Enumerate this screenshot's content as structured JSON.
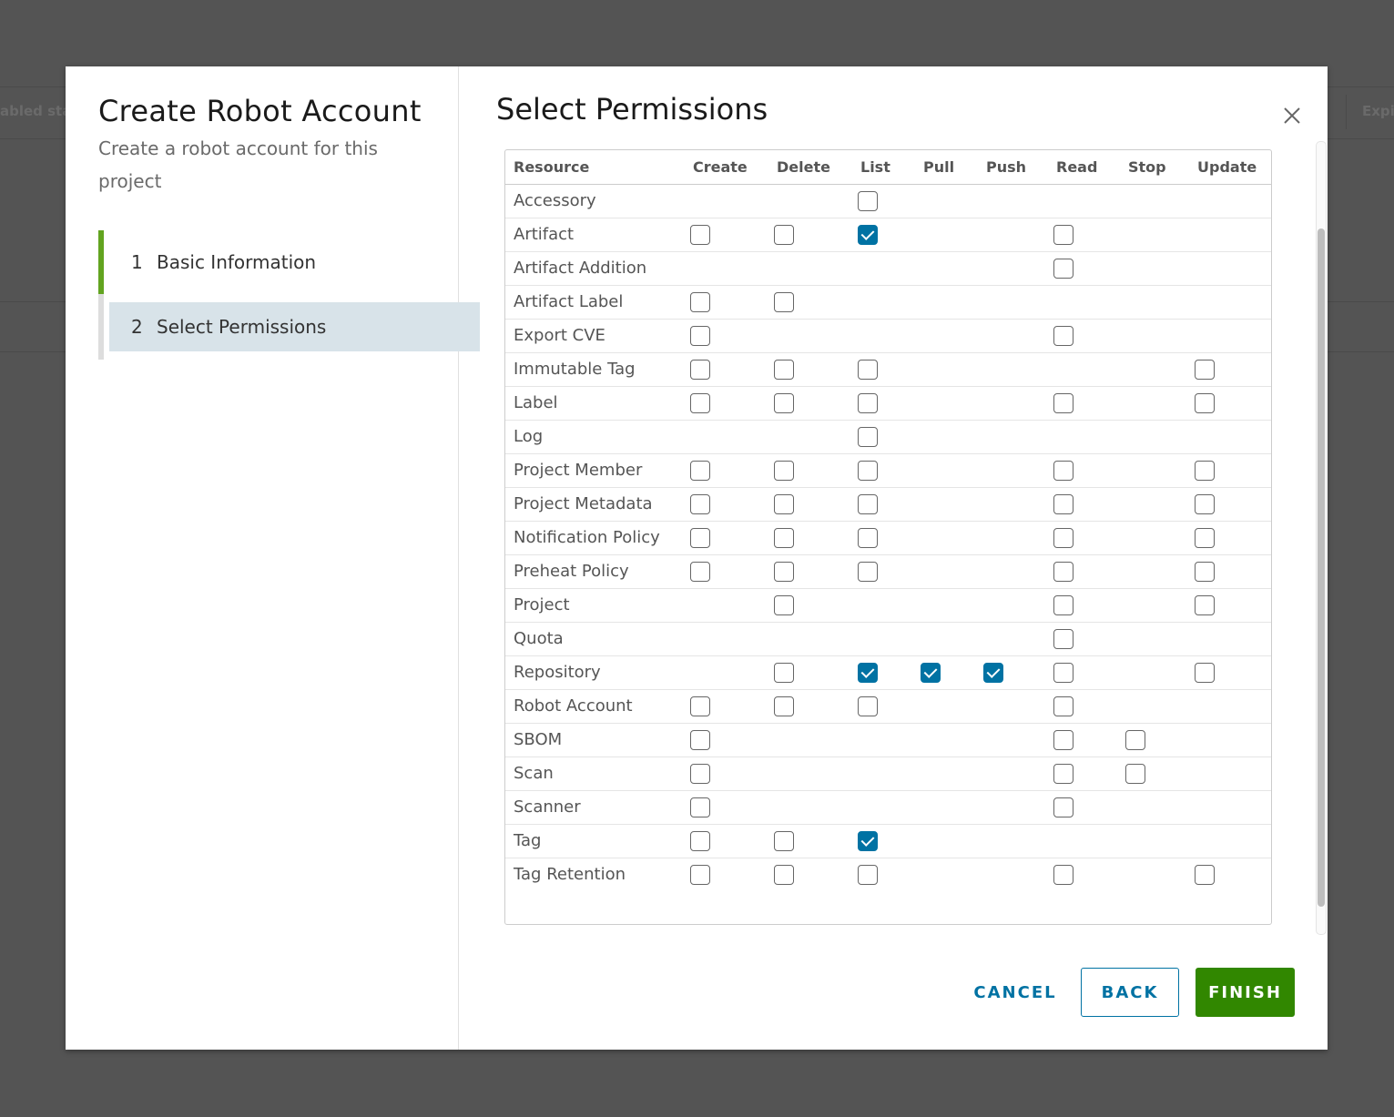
{
  "background": {
    "left_text": "abled sta",
    "right_text": "Expi"
  },
  "wizard": {
    "title": "Create Robot Account",
    "subtitle": "Create a robot account for this project",
    "steps": [
      {
        "num": "1",
        "label": "Basic Information"
      },
      {
        "num": "2",
        "label": "Select Permissions"
      }
    ]
  },
  "content": {
    "title": "Select Permissions"
  },
  "table": {
    "columns": [
      "Resource",
      "Create",
      "Delete",
      "List",
      "Pull",
      "Push",
      "Read",
      "Stop",
      "Update"
    ],
    "rows": [
      {
        "resource": "Accessory",
        "perms": {
          "list": false
        }
      },
      {
        "resource": "Artifact",
        "perms": {
          "create": false,
          "delete": false,
          "list": true,
          "read": false
        }
      },
      {
        "resource": "Artifact Addition",
        "perms": {
          "read": false
        }
      },
      {
        "resource": "Artifact Label",
        "perms": {
          "create": false,
          "delete": false
        }
      },
      {
        "resource": "Export CVE",
        "perms": {
          "create": false,
          "read": false
        }
      },
      {
        "resource": "Immutable Tag",
        "perms": {
          "create": false,
          "delete": false,
          "list": false,
          "update": false
        }
      },
      {
        "resource": "Label",
        "perms": {
          "create": false,
          "delete": false,
          "list": false,
          "read": false,
          "update": false
        }
      },
      {
        "resource": "Log",
        "perms": {
          "list": false
        }
      },
      {
        "resource": "Project Member",
        "perms": {
          "create": false,
          "delete": false,
          "list": false,
          "read": false,
          "update": false
        }
      },
      {
        "resource": "Project Metadata",
        "perms": {
          "create": false,
          "delete": false,
          "list": false,
          "read": false,
          "update": false
        }
      },
      {
        "resource": "Notification Policy",
        "perms": {
          "create": false,
          "delete": false,
          "list": false,
          "read": false,
          "update": false
        }
      },
      {
        "resource": "Preheat Policy",
        "perms": {
          "create": false,
          "delete": false,
          "list": false,
          "read": false,
          "update": false
        }
      },
      {
        "resource": "Project",
        "perms": {
          "delete": false,
          "read": false,
          "update": false
        }
      },
      {
        "resource": "Quota",
        "perms": {
          "read": false
        }
      },
      {
        "resource": "Repository",
        "perms": {
          "delete": false,
          "list": true,
          "pull": true,
          "push": true,
          "read": false,
          "update": false
        }
      },
      {
        "resource": "Robot Account",
        "perms": {
          "create": false,
          "delete": false,
          "list": false,
          "read": false
        }
      },
      {
        "resource": "SBOM",
        "perms": {
          "create": false,
          "read": false,
          "stop": false
        }
      },
      {
        "resource": "Scan",
        "perms": {
          "create": false,
          "read": false,
          "stop": false
        }
      },
      {
        "resource": "Scanner",
        "perms": {
          "create": false,
          "read": false
        }
      },
      {
        "resource": "Tag",
        "perms": {
          "create": false,
          "delete": false,
          "list": true
        }
      },
      {
        "resource": "Tag Retention",
        "perms": {
          "create": false,
          "delete": false,
          "list": false,
          "read": false,
          "update": false
        }
      }
    ]
  },
  "buttons": {
    "cancel": "CANCEL",
    "back": "BACK",
    "finish": "FINISH"
  },
  "colors": {
    "accent": "#0072a3",
    "finish": "#318700",
    "step_done": "#62a420",
    "step_active_bg": "#d8e3e9"
  },
  "icons": {
    "close": "close-icon",
    "check": "checkmark-icon"
  }
}
